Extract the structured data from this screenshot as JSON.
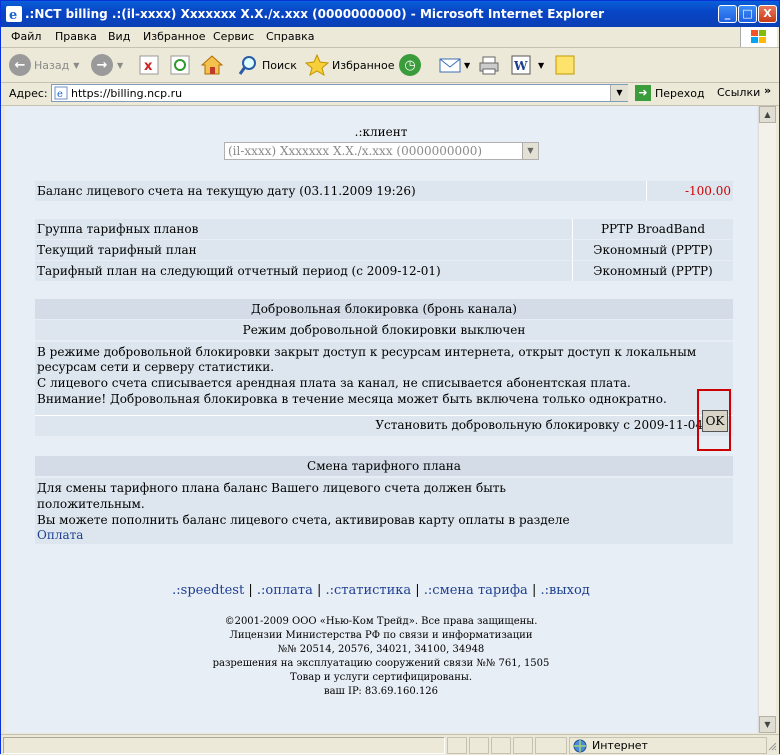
{
  "window": {
    "title": ".:NCT billing .:(il-xxxx) Xxxxxxx X.X./x.xxx (0000000000) - Microsoft Internet Explorer",
    "minimize": "_",
    "maximize": "□",
    "close": "X"
  },
  "menu": [
    "Файл",
    "Правка",
    "Вид",
    "Избранное",
    "Сервис",
    "Справка"
  ],
  "toolbar": {
    "back": "Назад",
    "search": "Поиск",
    "favorites": "Избранное"
  },
  "address": {
    "label": "Адрес:",
    "url": "https://billing.ncp.ru",
    "go": "Переход",
    "links": "Ссылки",
    "more": "»"
  },
  "page": {
    "client_label": ".:клиент",
    "client_select": "(il-xxxx) Xxxxxxx X.X./x.xxx (0000000000)",
    "balance_label": "Баланс лицевого счета на текущую дату (03.11.2009 19:26)",
    "balance_value": "-100.00",
    "tariff_rows": [
      {
        "label": "Группа тарифных планов",
        "value": "PPTP BroadBand"
      },
      {
        "label": "Текущий тарифный план",
        "value": "Экономный (PPTP)"
      },
      {
        "label": "Тарифный план на следующий отчетный период (с 2009-12-01)",
        "value": "Экономный (PPTP)"
      }
    ],
    "block_header": "Добровольная блокировка (бронь канала)",
    "block_status": "Режим добровольной блокировки выключен",
    "block_text_1": "В режиме добровольной блокировки закрыт доступ к ресурсам интернета, открыт доступ к локальным",
    "block_text_2": "ресурсам сети и серверу статистики.",
    "block_text_3": "С лицевого счета списывается арендная плата за канал, не списывается абонентская плата.",
    "block_text_4": "Внимание! Добровольная блокировка в течение месяца может быть включена только однократно.",
    "block_set_label": "Установить добровольную блокировку с 2009-11-04",
    "ok_button": "OK",
    "change_header": "Смена тарифного плана",
    "change_text_1": "Для смены тарифного плана баланс Вашего лицевого счета должен быть",
    "change_text_2": "положительным.",
    "change_text_3": "Вы можете пополнить баланс лицевого счета, активировав карту оплаты в разделе",
    "change_link": "Оплата",
    "nav": [
      ".:speedtest",
      ".:оплата",
      ".:статистика",
      ".:смена тарифа",
      ".:выход"
    ],
    "nav_sep": "|",
    "footer": [
      "©2001-2009 ООО «Нью-Ком Трейд». Все права защищены.",
      "Лицензии Министерства РФ по связи и информатизации",
      "№№ 20514, 20576, 34021, 34100, 34948",
      "разрешения на эксплуатацию сооружений связи №№ 761, 1505",
      "Товар и услуги сертифицированы.",
      "ваш IP: 83.69.160.126"
    ]
  },
  "status": {
    "zone": "Интернет"
  },
  "colors": {
    "negative_balance": "#cc0000",
    "highlight_box": "#cc0000",
    "band": "#dde6ee",
    "page_bg": "#e8eef5"
  }
}
